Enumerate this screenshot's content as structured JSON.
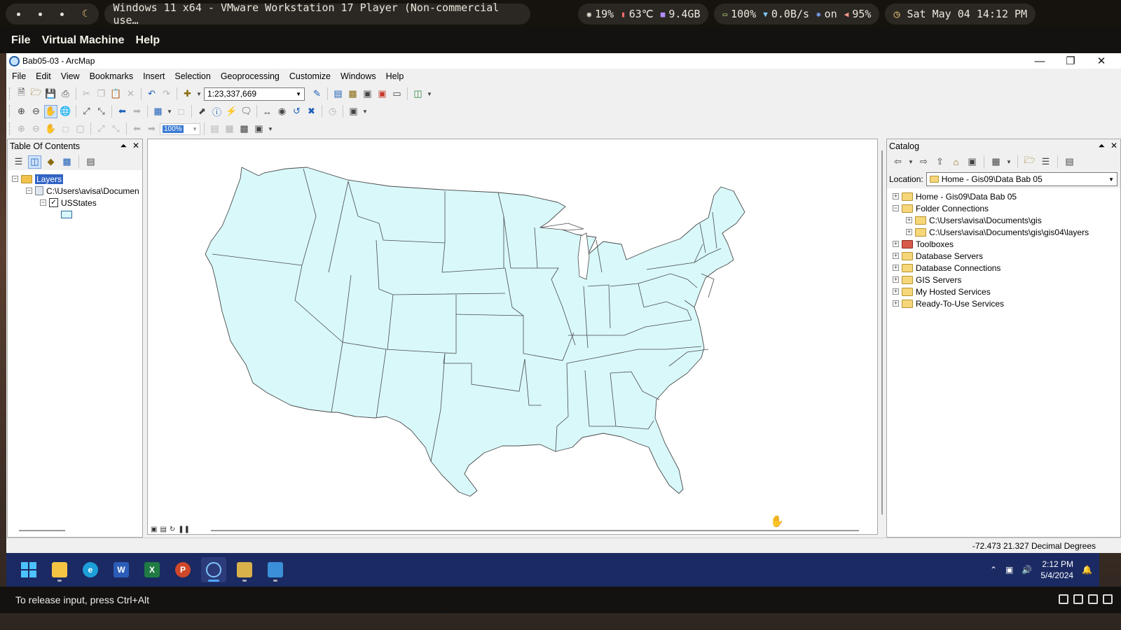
{
  "host_bar": {
    "vm_title": "Windows 11 x64 - VMware Workstation 17 Player (Non-commercial use…",
    "cpu": "19%",
    "temp": "63℃",
    "memory": "9.4GB",
    "battery": "100%",
    "network": "0.0B/s",
    "bluetooth": "on",
    "volume": "95%",
    "datetime": "Sat May 04 14:12 PM"
  },
  "vmware_menu": [
    "File",
    "Virtual Machine",
    "Help"
  ],
  "window": {
    "title": "Bab05-03 - ArcMap"
  },
  "menu": [
    "File",
    "Edit",
    "View",
    "Bookmarks",
    "Insert",
    "Selection",
    "Geoprocessing",
    "Customize",
    "Windows",
    "Help"
  ],
  "toolbar": {
    "scale": "1:23,337,669",
    "zoom_percent": "100%"
  },
  "toc": {
    "title": "Table Of Contents",
    "layers_label": "Layers",
    "source_path": "C:\\Users\\avisa\\Documen",
    "layer_name": "USStates"
  },
  "catalog": {
    "title": "Catalog",
    "location_label": "Location:",
    "location_value": "Home - Gis09\\Data Bab 05",
    "items": [
      "Home - Gis09\\Data Bab 05",
      "Folder Connections",
      "C:\\Users\\avisa\\Documents\\gis",
      "C:\\Users\\avisa\\Documents\\gis\\gis04\\layers",
      "Toolboxes",
      "Database Servers",
      "Database Connections",
      "GIS Servers",
      "My Hosted Services",
      "Ready-To-Use Services"
    ]
  },
  "status": {
    "coords": "-72.473  21.327 Decimal Degrees"
  },
  "taskbar": {
    "time": "2:12 PM",
    "date": "5/4/2024"
  },
  "vm_bottom": {
    "hint": "To release input, press Ctrl+Alt"
  },
  "colors": {
    "state_fill": "#d8f8fa",
    "taskbar": "#1b2a63",
    "selection": "#3163c5"
  }
}
